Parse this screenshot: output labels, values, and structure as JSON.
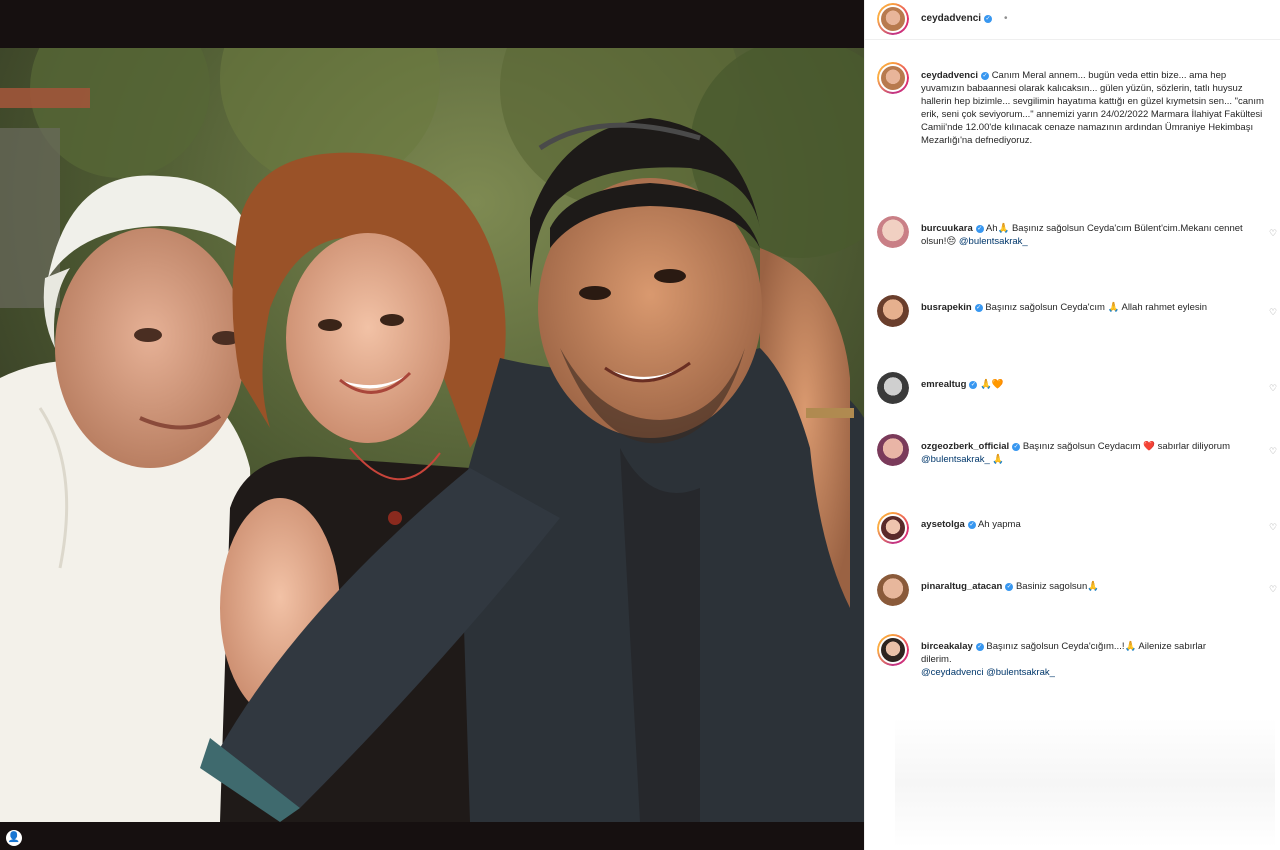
{
  "post": {
    "username": "ceydadvenci",
    "dot": "•",
    "caption": {
      "username": "ceydadvenci",
      "text": "Canım Meral annem... bugün veda ettin bize... ama hep yuvamızın babaannesi olarak kalıcaksın... gülen yüzün, sözlerin, tatlı huysuz hallerin hep bizimle... sevgilimin hayatıma kattığı en güzel kıymetsin sen... \"canım erik, seni çok seviyorum...\" annemizi yarın 24/02/2022 Marmara İlahiyat Fakültesi Camii'nde 12.00'de kılınacak cenaze namazının ardından Ümraniye Hekimbaşı Mezarlığı'na defnediyoruz."
    }
  },
  "comments": [
    {
      "username": "burcuukara",
      "text": "Ah🙏 Başınız sağolsun Ceyda'cım Bülent'cim.Mekanı cennet olsun!😔 ",
      "mention": "@bulentsakrak_"
    },
    {
      "username": "busrapekin",
      "text": "Başınız sağolsun Ceyda'cım 🙏 Allah rahmet eylesin",
      "mention": ""
    },
    {
      "username": "emrealtug",
      "text": "🙏🧡",
      "mention": ""
    },
    {
      "username": "ozgeozberk_official",
      "text": "Başınız sağolsun Ceydacım ❤️ sabırlar diliyorum ",
      "mention": "@bulentsakrak_",
      "after": " 🙏"
    },
    {
      "username": "aysetolga",
      "text": "Ah yapma",
      "mention": ""
    },
    {
      "username": "pinaraltug_atacan",
      "text": "Basiniz sagolsun🙏",
      "mention": ""
    },
    {
      "username": "birceakalay",
      "text": "Başınız sağolsun Ceyda'cığım...!🙏 Ailenize sabırlar dilerim.",
      "mention": "@ceydadvenci @bulentsakrak_"
    }
  ],
  "icons": {
    "heart": "♡",
    "tag": "👤",
    "verified": "✓"
  },
  "colors": {
    "verified_blue": "#3897f0",
    "mention": "#00376b",
    "muted": "#8e8e8e"
  }
}
